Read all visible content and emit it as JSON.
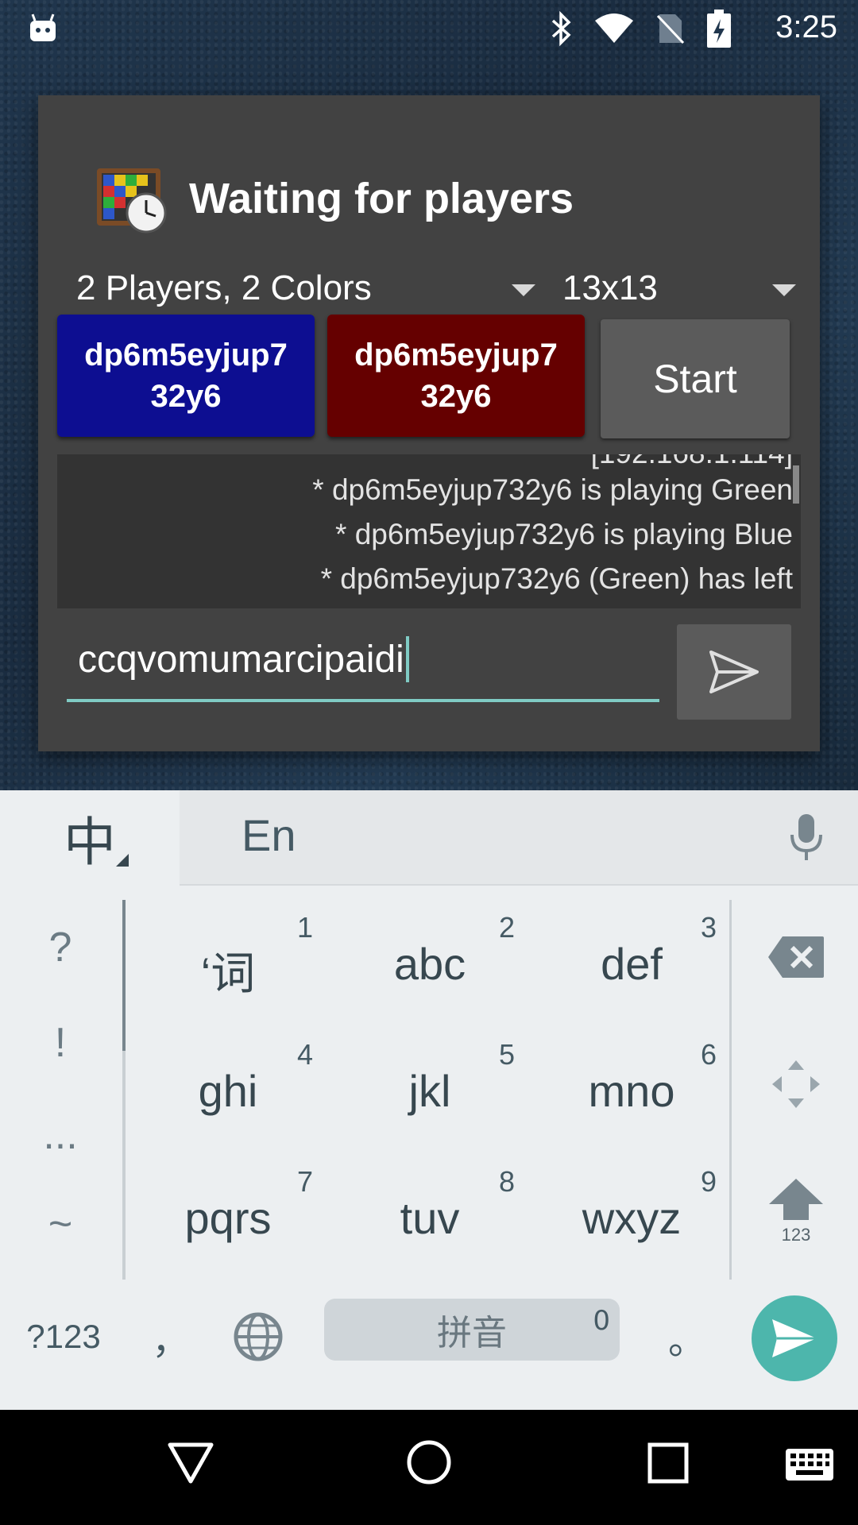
{
  "status_bar": {
    "time": "3:25",
    "icons": [
      "android-notification-icon",
      "bluetooth-icon",
      "wifi-icon",
      "no-sim-icon",
      "battery-charging-icon"
    ]
  },
  "dialog": {
    "title": "Waiting for players",
    "game_mode": "2 Players, 2 Colors",
    "board_size": "13x13",
    "players": [
      {
        "name": "dp6m5eyjup7\n32y6",
        "color": "#0d0e91"
      },
      {
        "name": "dp6m5eyjup7\n32y6",
        "color": "#650000"
      }
    ],
    "start_label": "Start",
    "chat_partial_line": "[192.168.1.114]",
    "chat": [
      "* dp6m5eyjup732y6 is playing Green",
      "* dp6m5eyjup732y6 is playing Blue",
      "* dp6m5eyjup732y6 (Green) has left"
    ],
    "message_value": "ccqvomumarcipaidi"
  },
  "keyboard": {
    "language_key": "中",
    "candidate": "En",
    "side_keys": [
      "?",
      "!",
      "...",
      "~"
    ],
    "keys": [
      {
        "label": "‘词",
        "num": "1"
      },
      {
        "label": "abc",
        "num": "2"
      },
      {
        "label": "def",
        "num": "3"
      },
      {
        "label": "ghi",
        "num": "4"
      },
      {
        "label": "jkl",
        "num": "5"
      },
      {
        "label": "mno",
        "num": "6"
      },
      {
        "label": "pqrs",
        "num": "7"
      },
      {
        "label": "tuv",
        "num": "8"
      },
      {
        "label": "wxyz",
        "num": "9"
      }
    ],
    "shift_sub": "123",
    "symbols_key": "?123",
    "comma_key": "，",
    "space_label": "拼音",
    "space_num": "0",
    "period_key": "。",
    "accent_color": "#4db6ac"
  }
}
